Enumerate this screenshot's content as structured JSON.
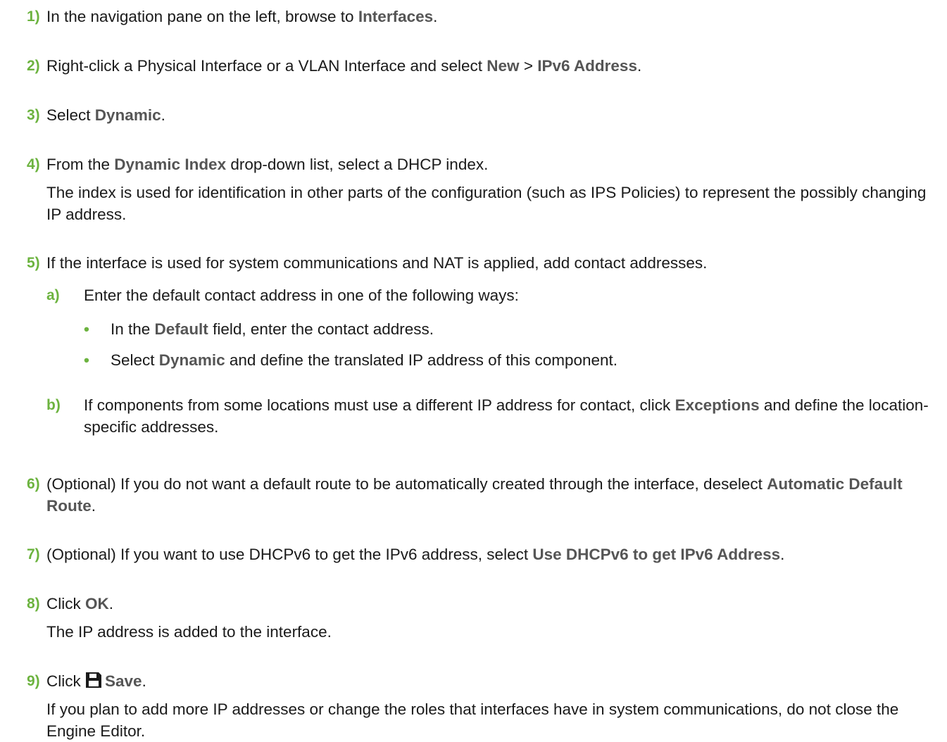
{
  "steps": [
    {
      "num": "1)",
      "parts": [
        "In the navigation pane on the left, browse to ",
        "Interfaces",
        "."
      ]
    },
    {
      "num": "2)",
      "parts": [
        "Right-click a Physical Interface or a VLAN Interface and select ",
        "New",
        " > ",
        "IPv6 Address",
        "."
      ]
    },
    {
      "num": "3)",
      "parts": [
        "Select ",
        "Dynamic",
        "."
      ]
    },
    {
      "num": "4)",
      "parts": [
        "From the ",
        "Dynamic Index",
        " drop-down list, select a DHCP index."
      ],
      "note": "The index is used for identification in other parts of the configuration (such as IPS Policies) to represent the possibly changing IP address."
    },
    {
      "num": "5)",
      "text": "If the interface is used for system communications and NAT is applied, add contact addresses.",
      "sub_a": {
        "num": "a)",
        "text": "Enter the default contact address in one of the following ways:"
      },
      "bullet_1": {
        "dot": "•",
        "parts": [
          "In the ",
          "Default",
          " field, enter the contact address."
        ]
      },
      "bullet_2": {
        "dot": "•",
        "parts": [
          "Select ",
          "Dynamic",
          " and define the translated IP address of this component."
        ]
      },
      "sub_b": {
        "num": "b)",
        "parts": [
          "If components from some locations must use a different IP address for contact, click ",
          "Exceptions",
          " and define the location-specific addresses."
        ]
      }
    },
    {
      "num": "6)",
      "parts": [
        "(Optional) If you do not want a default route to be automatically created through the interface, deselect ",
        "Automatic Default Route",
        "."
      ]
    },
    {
      "num": "7)",
      "parts": [
        "(Optional) If you want to use DHCPv6 to get the IPv6 address, select ",
        "Use DHCPv6 to get IPv6 Address",
        "."
      ]
    },
    {
      "num": "8)",
      "parts": [
        "Click ",
        "OK",
        "."
      ],
      "note": "The IP address is added to the interface."
    },
    {
      "num": "9)",
      "parts": [
        "Click ",
        "Save",
        "."
      ],
      "icon": "save-icon",
      "note": "If you plan to add more IP addresses or change the roles that interfaces have in system communications, do not close the Engine Editor."
    }
  ],
  "colors": {
    "accent": "#6cb33f",
    "ui_label": "#555555",
    "text": "#1a1a1a"
  }
}
